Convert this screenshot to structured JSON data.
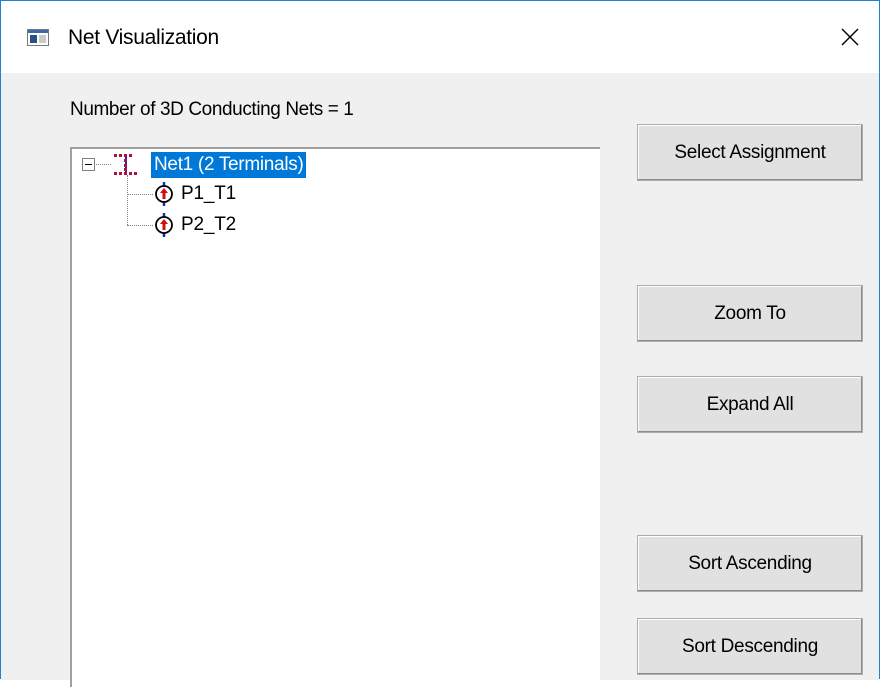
{
  "window": {
    "title": "Net Visualization",
    "close_icon": "close-icon",
    "app_icon": "window-app-icon"
  },
  "summary": {
    "net_count_text": "Number of 3D Conducting Nets = 1"
  },
  "tree": {
    "root": {
      "label": "Net1 (2 Terminals)",
      "icon": "net-icon",
      "expanded": true,
      "selected": true,
      "children": [
        {
          "label": "P1_T1",
          "icon": "terminal-icon"
        },
        {
          "label": "P2_T2",
          "icon": "terminal-icon"
        }
      ]
    }
  },
  "buttons": {
    "select_assignment": "Select Assignment",
    "zoom_to": "Zoom To",
    "expand_all": "Expand All",
    "sort_ascending": "Sort Ascending",
    "sort_descending": "Sort Descending"
  },
  "colors": {
    "selection": "#0078d7",
    "window_border": "#1883d7",
    "dialog_bg": "#f0f0f0",
    "net_icon_dots": "#b0103a",
    "terminal_line": "#1030c0",
    "terminal_arrow": "#d01010"
  }
}
